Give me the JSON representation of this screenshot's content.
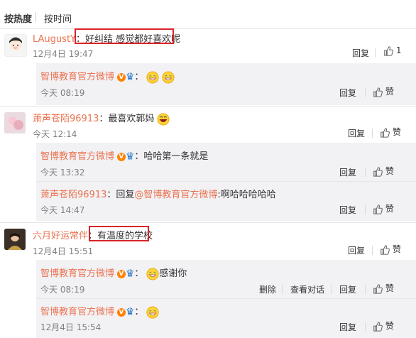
{
  "sort": {
    "by_hot": "按热度",
    "by_time": "按时间"
  },
  "comments": [
    {
      "user": "LAugustY",
      "separator": "：",
      "text": "好纠结 感觉都好喜欢呢",
      "time": "12月4日 19:47",
      "reply_label": "回复",
      "like_count": "1",
      "replies": [
        {
          "user": "智博教育官方微博",
          "separator": "：",
          "text": "",
          "emojis": [
            "grin-emoji",
            "grin-emoji"
          ],
          "time": "今天 08:19",
          "reply_label": "回复",
          "like_label": "赞"
        }
      ]
    },
    {
      "user": "萧声苍陌96913",
      "separator": "：",
      "text": "最喜欢郭妈",
      "time": "今天 12:14",
      "reply_label": "回复",
      "like_label": "赞",
      "replies": [
        {
          "user": "智博教育官方微博",
          "separator": "：",
          "text": "哈哈第一条就是",
          "time": "今天 13:32",
          "reply_label": "回复",
          "like_label": "赞"
        },
        {
          "user": "萧声苍陌96913",
          "separator": "：回复",
          "mention": "@智博教育官方微博",
          "text": ":啊哈哈哈哈哈",
          "time": "今天 14:47",
          "reply_label": "回复",
          "like_label": "赞"
        }
      ]
    },
    {
      "user": "六月好运常伴",
      "separator": "：",
      "text": "有温度的学校",
      "time": "12月4日 15:51",
      "reply_label": "回复",
      "like_label": "赞",
      "replies": [
        {
          "user": "智博教育官方微博",
          "separator": "：",
          "text": "感谢你",
          "time": "今天 08:19",
          "delete_label": "删除",
          "view_label": "查看对话",
          "reply_label": "回复",
          "like_label": "赞"
        },
        {
          "user": "智博教育官方微博",
          "separator": "：",
          "text": "",
          "time": "12月4日 15:54",
          "reply_label": "回复",
          "like_label": "赞"
        }
      ]
    }
  ],
  "badge": {
    "v": "V",
    "crown": "♛"
  },
  "colors": {
    "name": "#eb7350",
    "mention": "#eb7350",
    "reply_bg": "#f2f2f5",
    "highlight_box": "#d9232a",
    "verified": "#2b78ca"
  }
}
